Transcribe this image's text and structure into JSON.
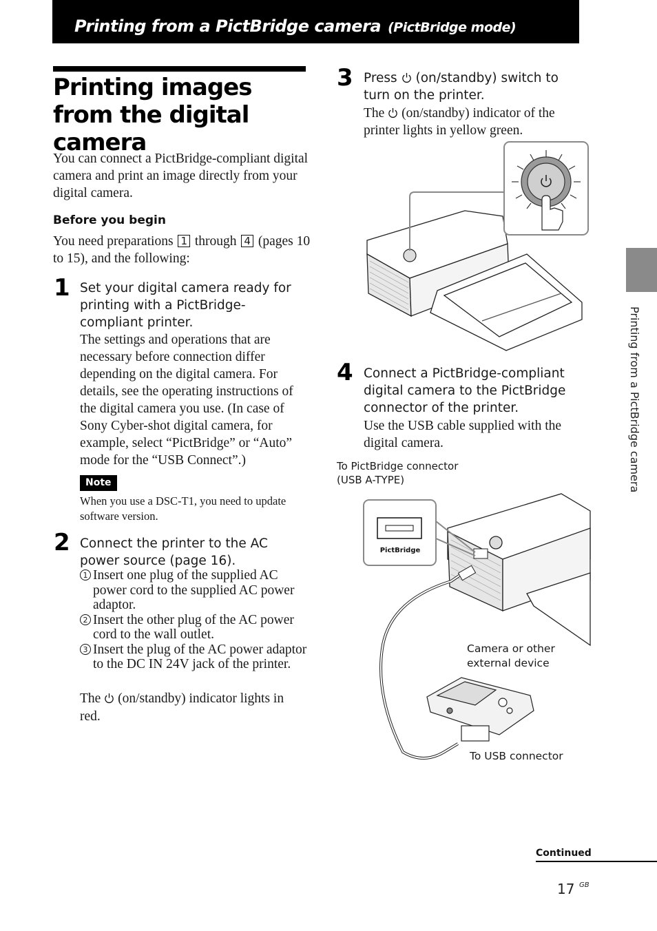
{
  "header": {
    "section_title": "Printing from a PictBridge camera",
    "section_subtitle": "(PictBridge mode)"
  },
  "page_title": "Printing images from the digital camera",
  "intro": "You can connect a PictBridge-compliant digital camera and print an image directly from your digital camera.",
  "before_you_begin": {
    "heading": "Before you begin",
    "text_before": "You need preparations",
    "box_start": "1",
    "text_middle": "through",
    "box_end": "4",
    "text_after": "(pages 10 to 15), and the following:"
  },
  "steps": [
    {
      "number": "1",
      "heading": "Set your digital camera ready for printing with a PictBridge-compliant printer.",
      "body": "The settings and operations that are necessary before connection differ depending on the digital camera. For details, see the operating instructions of the digital camera you use. (In case of Sony Cyber-shot digital camera, for example, select “PictBridge” or “Auto” mode for the “USB Connect”.)"
    },
    {
      "number": "2",
      "heading": "Connect the printer to the AC power source (page 16).",
      "substeps": [
        {
          "marker": "1",
          "text": "Insert one plug of the supplied AC power cord to the supplied AC power adaptor."
        },
        {
          "marker": "2",
          "text": "Insert the other plug of the AC power cord to the wall outlet."
        },
        {
          "marker": "3",
          "text": "Insert the plug of the AC power adaptor to the DC IN 24V jack of the printer."
        }
      ],
      "result_before": "The",
      "result_after": "(on/standby) indicator lights in red."
    },
    {
      "number": "3",
      "heading_before": "Press",
      "heading_after": "(on/standby) switch to turn on the printer.",
      "body_before": "The",
      "body_after": "(on/standby) indicator of the printer lights in yellow green."
    },
    {
      "number": "4",
      "heading": "Connect a PictBridge-compliant digital camera to the PictBridge connector of the printer.",
      "body": "Use the USB cable supplied with the digital camera."
    }
  ],
  "note": {
    "label": "Note",
    "text": "When you use a DSC-T1, you need to update software version."
  },
  "figure_labels": {
    "pictbridge_connector_line1": "To PictBridge connector",
    "pictbridge_connector_line2": "(USB A-TYPE)",
    "pictbridge_port": "PictBridge",
    "camera_line1": "Camera or other",
    "camera_line2": "external device",
    "usb_connector": "To USB connector"
  },
  "side_tab": {
    "label": "Printing from a PictBridge camera"
  },
  "footer": {
    "continued": "Continued",
    "page_number": "17",
    "language": "GB"
  }
}
